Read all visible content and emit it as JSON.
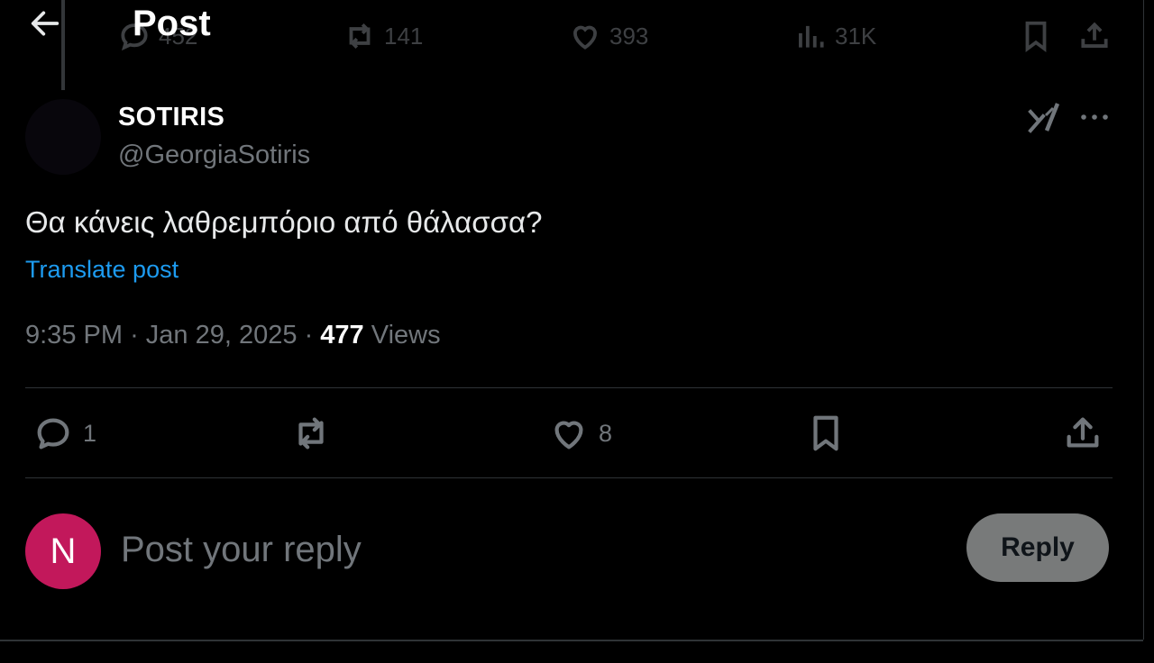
{
  "header": {
    "title": "Post"
  },
  "parent_post_stats": {
    "replies": "452",
    "reposts": "141",
    "likes": "393",
    "views": "31K"
  },
  "post": {
    "display_name": "SOTIRIS",
    "handle": "@GeorgiaSotiris",
    "text": "Θα κάνεις λαθρεμπόριο από θάλασσα?",
    "translate_label": "Translate post",
    "time": "9:35 PM",
    "separator": "·",
    "date": "Jan 29, 2025",
    "views_count": "477",
    "views_label": "Views"
  },
  "actions": {
    "replies": "1",
    "likes": "8"
  },
  "composer": {
    "avatar_letter": "N",
    "placeholder": "Post your reply",
    "reply_button": "Reply"
  },
  "colors": {
    "background": "#000000",
    "link": "#1d9bf0",
    "muted": "#71767b",
    "avatar": "#c2185b",
    "reply_button": "#787a7a"
  }
}
